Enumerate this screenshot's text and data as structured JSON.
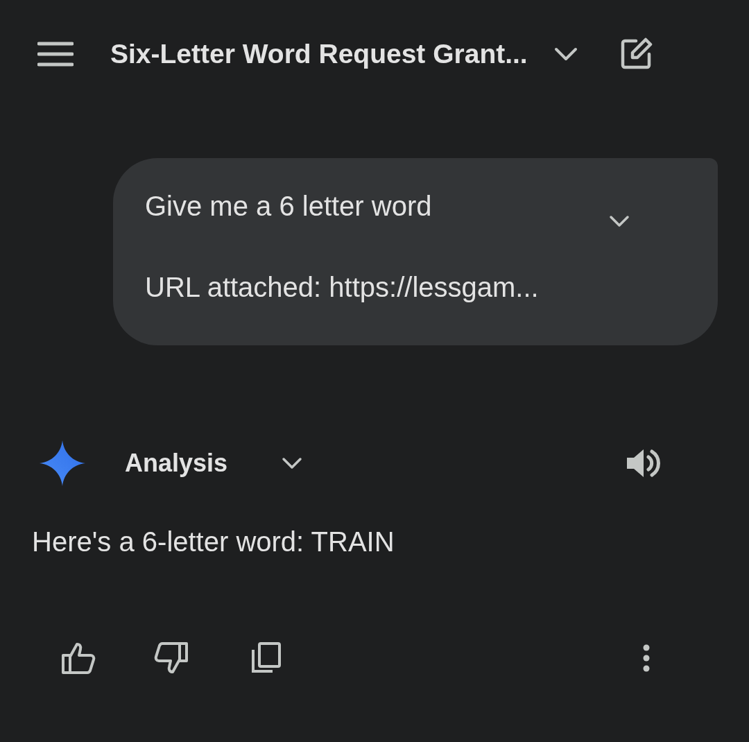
{
  "header": {
    "title": "Six-Letter Word Request Grant..."
  },
  "user_message": {
    "text": "Give me a 6 letter word",
    "attachment": "URL attached: https://lessgam..."
  },
  "response": {
    "label": "Analysis",
    "text": "Here's a 6-letter word: TRAIN"
  }
}
